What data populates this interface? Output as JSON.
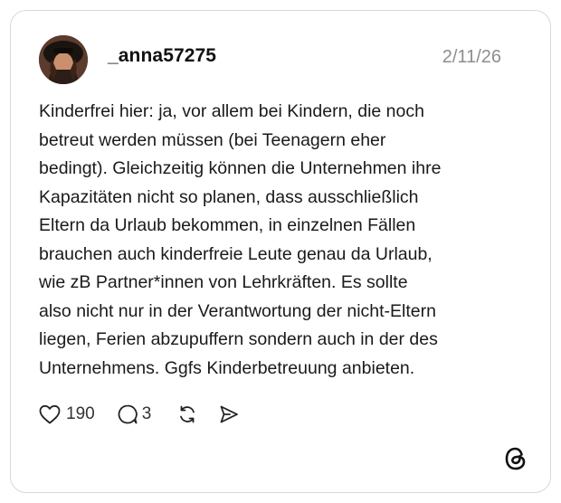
{
  "post": {
    "username": "_anna57275",
    "date": "2/11/26",
    "text": "Kinderfrei hier: ja, vor allem bei Kindern, die noch\nbetreut werden müssen (bei Teenagern eher\nbedingt). Gleichzeitig können die Unternehmen ihre\nKapazitäten nicht so planen, dass ausschließlich\nEltern da Urlaub bekommen, in einzelnen Fällen\nbrauchen auch kinderfreie Leute genau da Urlaub,\nwie zB Partner*innen von Lehrkräften. Es sollte\nalso nicht nur in der Verantwortung der nicht-Eltern\nliegen, Ferien abzupuffern sondern auch in der des\nUnternehmens. Ggfs Kinderbetreuung anbieten."
  },
  "actions": {
    "like_count": "190",
    "reply_count": "3",
    "icons": [
      "heart-icon",
      "comment-icon",
      "repost-icon",
      "share-icon"
    ]
  },
  "branding": {
    "logo": "threads-logo-icon"
  }
}
